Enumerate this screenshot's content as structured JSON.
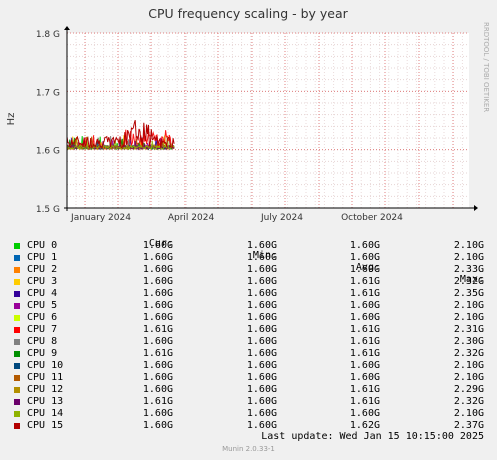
{
  "chart_data": {
    "type": "line",
    "title": "CPU frequency scaling - by year",
    "ylabel": "Hz",
    "side_label": "RRDTOOL / TOBI OETIKER",
    "ylim": [
      1.5,
      1.8
    ],
    "y_ticks": [
      {
        "value": 1.8,
        "label": "1.8 G"
      },
      {
        "value": 1.7,
        "label": "1.7 G"
      },
      {
        "value": 1.6,
        "label": "1.6 G"
      },
      {
        "value": 1.5,
        "label": "1.5 G"
      }
    ],
    "x_ticks": [
      "January 2024",
      "April 2024",
      "July 2024",
      "October 2024"
    ],
    "grid": true,
    "series": [
      {
        "name": "CPU 0",
        "color": "#00cc00",
        "max": 2.1
      },
      {
        "name": "CPU 1",
        "color": "#0066b3",
        "max": 2.1
      },
      {
        "name": "CPU 2",
        "color": "#ff8000",
        "max": 2.33
      },
      {
        "name": "CPU 3",
        "color": "#ffcc00",
        "max": 2.32
      },
      {
        "name": "CPU 4",
        "color": "#330099",
        "max": 2.35
      },
      {
        "name": "CPU 5",
        "color": "#990099",
        "max": 2.1
      },
      {
        "name": "CPU 6",
        "color": "#ccff00",
        "max": 2.1
      },
      {
        "name": "CPU 7",
        "color": "#ff0000",
        "max": 2.31
      },
      {
        "name": "CPU 8",
        "color": "#808080",
        "max": 2.3
      },
      {
        "name": "CPU 9",
        "color": "#008f00",
        "max": 2.32
      },
      {
        "name": "CPU 10",
        "color": "#00487d",
        "max": 2.1
      },
      {
        "name": "CPU 11",
        "color": "#b35a00",
        "max": 2.1
      },
      {
        "name": "CPU 12",
        "color": "#b38f00",
        "max": 2.29
      },
      {
        "name": "CPU 13",
        "color": "#6b006b",
        "max": 2.32
      },
      {
        "name": "CPU 14",
        "color": "#8fb300",
        "max": 2.1
      },
      {
        "name": "CPU 15",
        "color": "#b30000",
        "max": 2.37
      }
    ]
  },
  "legend": {
    "headers": {
      "cur": "Cur:",
      "min": "Min:",
      "avg": "Avg:",
      "max": "Max:"
    },
    "rows": [
      {
        "name": "CPU 0",
        "color": "#00cc00",
        "cur": "1.60G",
        "min": "1.60G",
        "avg": "1.60G",
        "max": "2.10G"
      },
      {
        "name": "CPU 1",
        "color": "#0066b3",
        "cur": "1.60G",
        "min": "1.60G",
        "avg": "1.60G",
        "max": "2.10G"
      },
      {
        "name": "CPU 2",
        "color": "#ff8000",
        "cur": "1.60G",
        "min": "1.60G",
        "avg": "1.60G",
        "max": "2.33G"
      },
      {
        "name": "CPU 3",
        "color": "#ffcc00",
        "cur": "1.60G",
        "min": "1.60G",
        "avg": "1.61G",
        "max": "2.32G"
      },
      {
        "name": "CPU 4",
        "color": "#330099",
        "cur": "1.60G",
        "min": "1.60G",
        "avg": "1.61G",
        "max": "2.35G"
      },
      {
        "name": "CPU 5",
        "color": "#990099",
        "cur": "1.60G",
        "min": "1.60G",
        "avg": "1.60G",
        "max": "2.10G"
      },
      {
        "name": "CPU 6",
        "color": "#ccff00",
        "cur": "1.60G",
        "min": "1.60G",
        "avg": "1.60G",
        "max": "2.10G"
      },
      {
        "name": "CPU 7",
        "color": "#ff0000",
        "cur": "1.61G",
        "min": "1.60G",
        "avg": "1.61G",
        "max": "2.31G"
      },
      {
        "name": "CPU 8",
        "color": "#808080",
        "cur": "1.60G",
        "min": "1.60G",
        "avg": "1.61G",
        "max": "2.30G"
      },
      {
        "name": "CPU 9",
        "color": "#008f00",
        "cur": "1.61G",
        "min": "1.60G",
        "avg": "1.61G",
        "max": "2.32G"
      },
      {
        "name": "CPU 10",
        "color": "#00487d",
        "cur": "1.60G",
        "min": "1.60G",
        "avg": "1.60G",
        "max": "2.10G"
      },
      {
        "name": "CPU 11",
        "color": "#b35a00",
        "cur": "1.60G",
        "min": "1.60G",
        "avg": "1.60G",
        "max": "2.10G"
      },
      {
        "name": "CPU 12",
        "color": "#b38f00",
        "cur": "1.60G",
        "min": "1.60G",
        "avg": "1.61G",
        "max": "2.29G"
      },
      {
        "name": "CPU 13",
        "color": "#6b006b",
        "cur": "1.61G",
        "min": "1.60G",
        "avg": "1.61G",
        "max": "2.32G"
      },
      {
        "name": "CPU 14",
        "color": "#8fb300",
        "cur": "1.60G",
        "min": "1.60G",
        "avg": "1.60G",
        "max": "2.10G"
      },
      {
        "name": "CPU 15",
        "color": "#b30000",
        "cur": "1.60G",
        "min": "1.60G",
        "avg": "1.62G",
        "max": "2.37G"
      }
    ]
  },
  "footer": {
    "last_update": "Last update: Wed Jan 15 10:15:00 2025",
    "munin_version": "Munin 2.0.33-1"
  }
}
